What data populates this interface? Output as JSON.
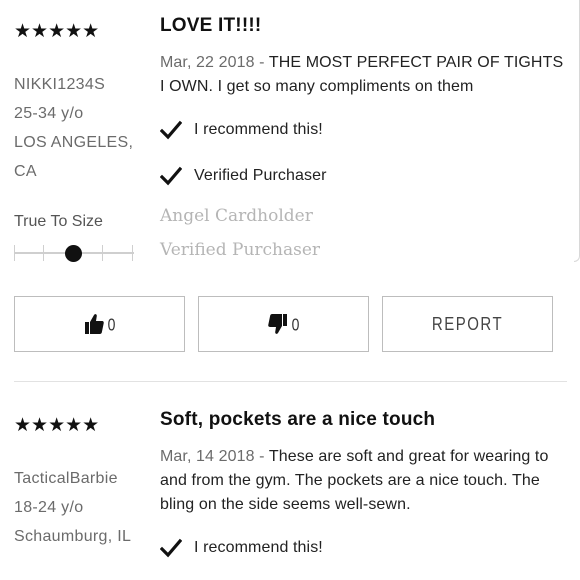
{
  "reviews": [
    {
      "stars": "★★★★★",
      "title": "LOVE IT!!!!",
      "username": "NIKKI1234S",
      "age": "25-34 y/o",
      "location": "LOS ANGELES, CA",
      "date": "Mar, 22 2018",
      "separator": " - ",
      "text": "THE MOST PERFECT PAIR OF TIGHTS I OWN. I get so many compliments on them",
      "recommend": "I recommend this!",
      "verified": "Verified Purchaser",
      "badge_program": "Angel Cardholder",
      "badge_verified": "Verified Purchaser",
      "fit_label": "True To Size",
      "fit_level": 0.5,
      "helpful_count": "0",
      "unhelpful_count": "0",
      "report_label": "REPORT"
    },
    {
      "stars": "★★★★★",
      "title": "Soft, pockets are a nice touch",
      "username": "TacticalBarbie",
      "age": "18-24 y/o",
      "location": "Schaumburg, IL",
      "date": "Mar, 14 2018",
      "separator": " - ",
      "text": "These are soft and great for wearing to and from the gym. The pockets are a nice touch. The bling on the side seems well-sewn.",
      "recommend": "I recommend this!"
    }
  ],
  "icons": {
    "check": "check-icon",
    "thumbs_up": "thumbs-up-icon",
    "thumbs_down": "thumbs-down-icon"
  }
}
